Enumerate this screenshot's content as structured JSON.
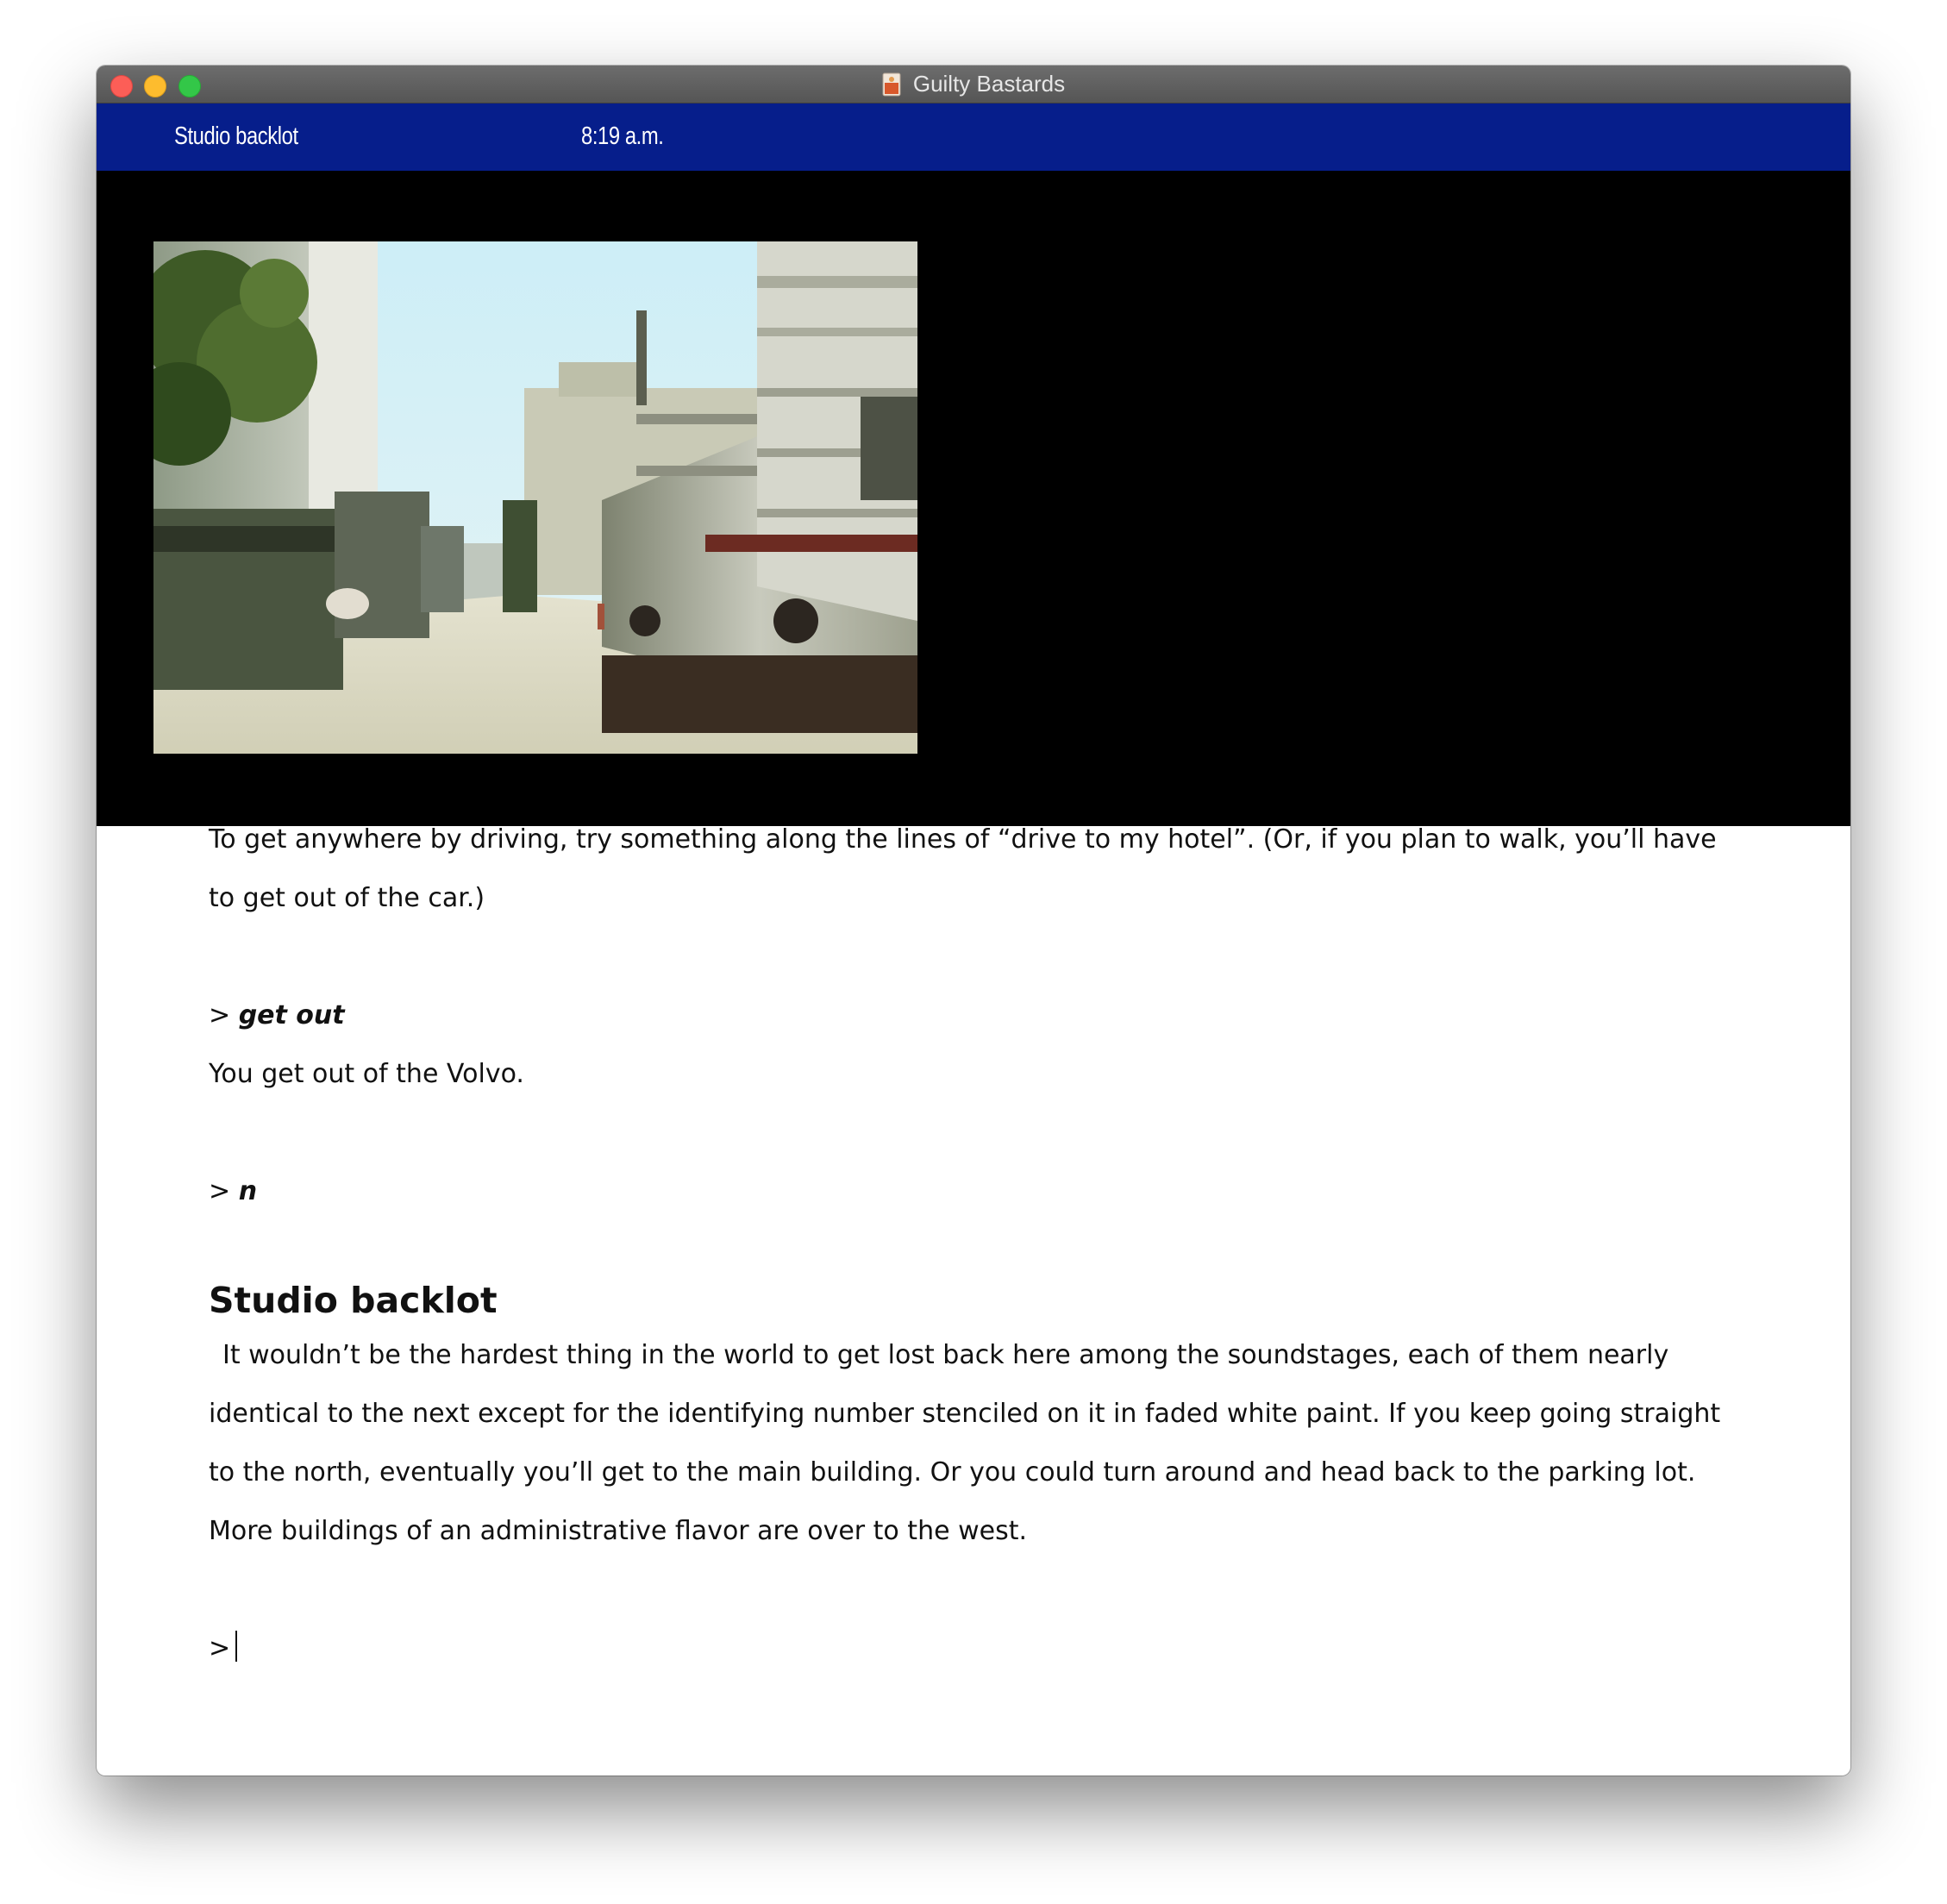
{
  "window": {
    "title": "Guilty Bastards"
  },
  "status_bar": {
    "location": "Studio backlot",
    "time": "8:19 a.m.",
    "background_color": "#061e8b"
  },
  "scene_image": {
    "description_icon": "studio-backlot-scene"
  },
  "transcript": {
    "intro_text": "To get anywhere by driving, try something along the lines of “drive to my hotel”. (Or, if you plan to walk, you’ll have to get out of the car.)",
    "command1_prompt": ">",
    "command1": "get out",
    "response1": "You get out of the Volvo.",
    "command2_prompt": ">",
    "command2": "n",
    "room_title": "Studio backlot",
    "room_description": "It wouldn’t be the hardest thing in the world to get lost back here among the soundstages, each of them nearly identical to the next except for the identifying number stenciled on it in faded white paint. If you keep going straight to the north, eventually you’ll get to the main building. Or you could turn around and head back to the parking lot. More buildings of an administrative flavor are over to the west.",
    "input_prompt": ">"
  }
}
